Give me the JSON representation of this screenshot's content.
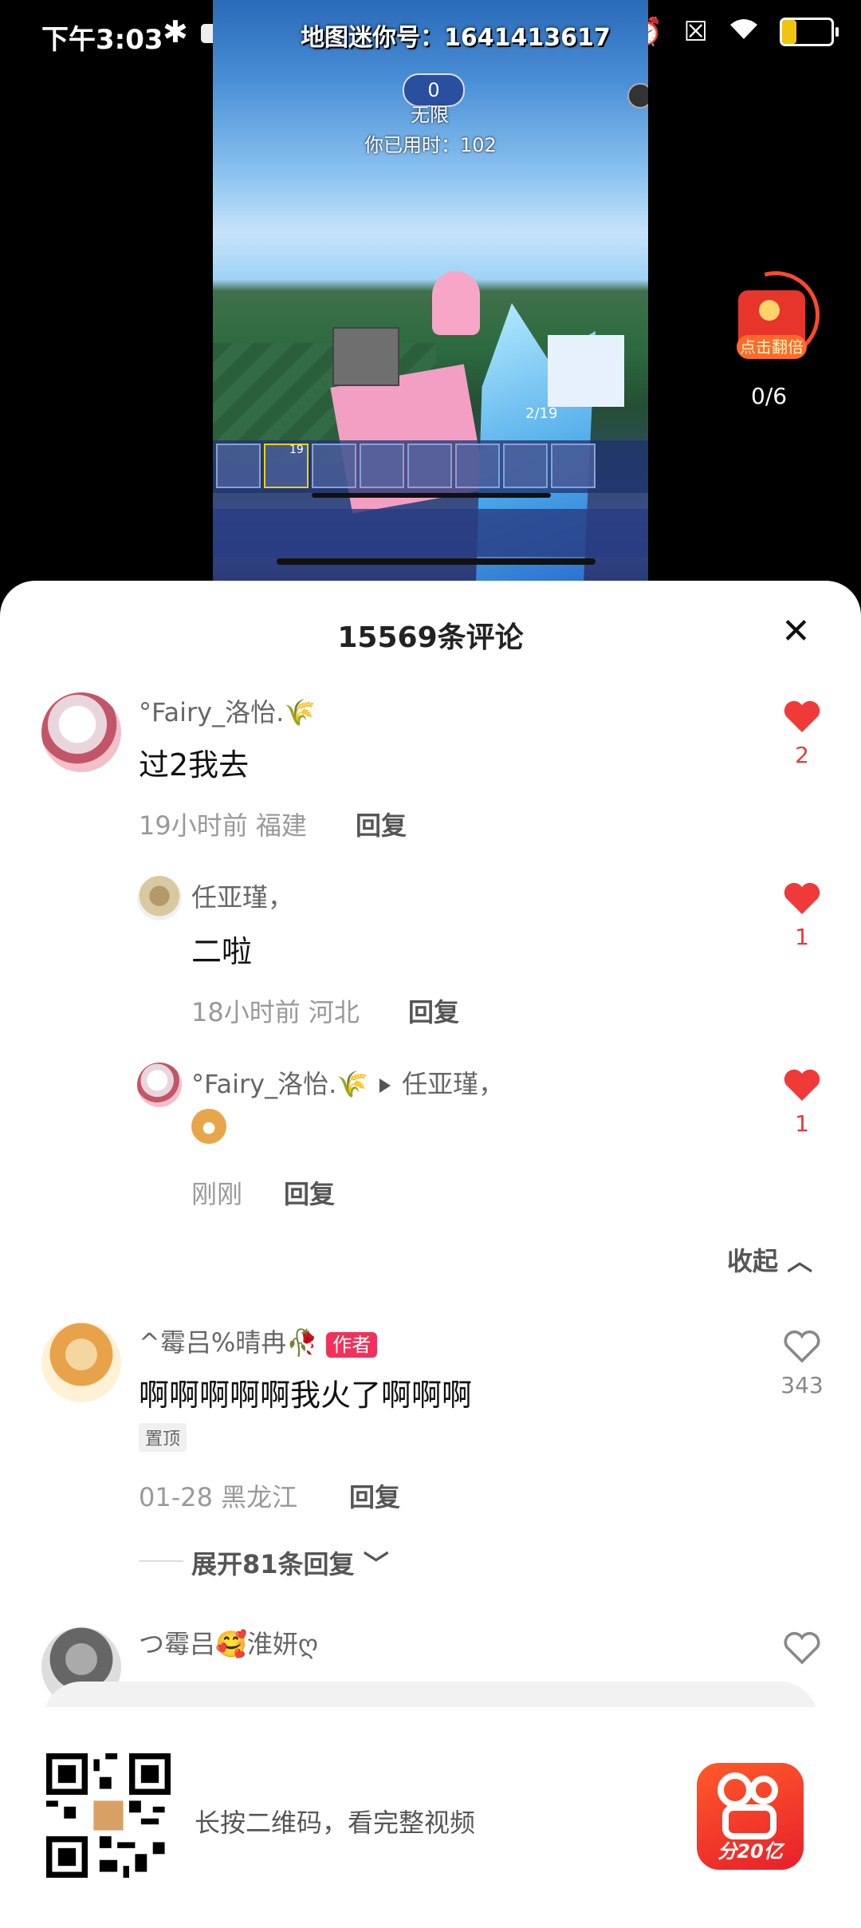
{
  "status_bar": {
    "time": "下午3:03",
    "battery": "29",
    "battery_level_percent": 29
  },
  "video": {
    "overlay_title": "地图迷你号：1641413617",
    "pill_value": "0",
    "mode_label": "无限",
    "time_used": "你已用时：102",
    "counter_text": "2/19",
    "hotbar_count": "19"
  },
  "red_packet": {
    "label": "点击翻倍",
    "progress": "0/6"
  },
  "comments": {
    "title": "15569条评论",
    "items": [
      {
        "user": "°Fairy_洛怡.🌾",
        "text": "过2我去",
        "meta": "19小时前 福建",
        "reply_label": "回复",
        "likes": "2",
        "liked": true
      }
    ],
    "replies": [
      {
        "user": "任亚瑾，",
        "text": "二啦",
        "meta": "18小时前 河北",
        "reply_label": "回复",
        "likes": "1",
        "liked": true
      },
      {
        "user": "°Fairy_洛怡.🌾",
        "reply_to": "任亚瑾，",
        "meta": "刚刚",
        "reply_label": "回复",
        "likes": "1",
        "liked": true
      }
    ],
    "collapse_label": "收起",
    "second": {
      "user": "^霉吕%晴冉🥀",
      "author_badge": "作者",
      "text": "啊啊啊啊啊我火了啊啊啊",
      "pinned": "置顶",
      "meta": "01-28 黑龙江",
      "reply_label": "回复",
      "likes": "343",
      "liked": false,
      "expand_label": "展开81条回复"
    },
    "third": {
      "user": "つ霉吕🥰淮妍ღ"
    }
  },
  "banner": {
    "text": "长按二维码，看完整视频",
    "app_badge": "分20亿"
  },
  "colors": {
    "like_red": "#e83a3a",
    "author_badge": "#f0325a"
  }
}
